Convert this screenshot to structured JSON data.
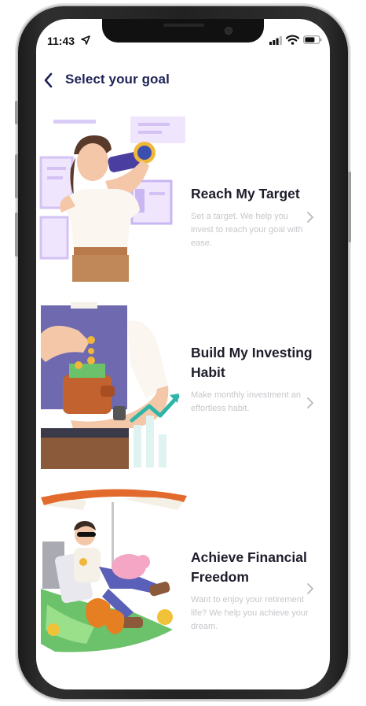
{
  "status": {
    "time": "11:43"
  },
  "header": {
    "title": "Select your goal"
  },
  "goals": [
    {
      "title": "Reach My Target",
      "description": "Set a target. We help you invest to reach your goal with ease."
    },
    {
      "title": "Build My Investing Habit",
      "description": "Make monthly investment an effortless habit."
    },
    {
      "title": "Achieve Financial Freedom",
      "description": "Want to enjoy your retirement life? We help you achieve your dream."
    }
  ],
  "colors": {
    "title": "#1e2356",
    "description": "#c7c7cc",
    "accent_purple": "#c9b6f2"
  },
  "icons": [
    "back-chevron-icon",
    "location-arrow-icon",
    "signal-icon",
    "wifi-icon",
    "battery-icon",
    "chevron-right-icon"
  ]
}
